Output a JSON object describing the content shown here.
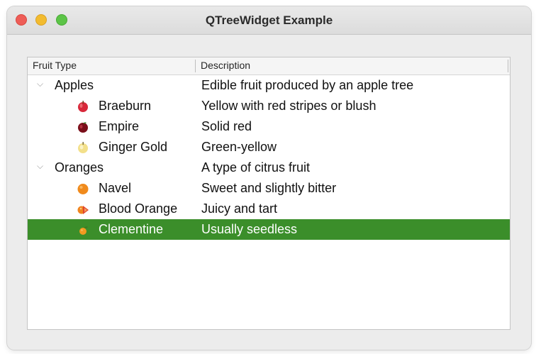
{
  "window": {
    "title": "QTreeWidget Example"
  },
  "tree": {
    "headers": [
      "Fruit Type",
      "Description"
    ],
    "rows": [
      {
        "name": "Apples",
        "desc": "Edible fruit produced by an apple tree",
        "level": 0,
        "expanded": true
      },
      {
        "name": "Braeburn",
        "desc": "Yellow with red stripes or blush",
        "level": 1,
        "icon": "red-apple-icon"
      },
      {
        "name": "Empire",
        "desc": "Solid red",
        "level": 1,
        "icon": "dark-red-apple-icon"
      },
      {
        "name": "Ginger Gold",
        "desc": "Green-yellow",
        "level": 1,
        "icon": "yellow-apple-icon"
      },
      {
        "name": "Oranges",
        "desc": "A type of citrus fruit",
        "level": 0,
        "expanded": true
      },
      {
        "name": "Navel",
        "desc": "Sweet and slightly bitter",
        "level": 1,
        "icon": "orange-icon"
      },
      {
        "name": "Blood Orange",
        "desc": "Juicy and tart",
        "level": 1,
        "icon": "blood-orange-icon"
      },
      {
        "name": "Clementine",
        "desc": "Usually seedless",
        "level": 1,
        "icon": "clementine-icon",
        "selected": true
      }
    ]
  },
  "colors": {
    "selection": "#3b8e2a",
    "window": "#ececec"
  }
}
